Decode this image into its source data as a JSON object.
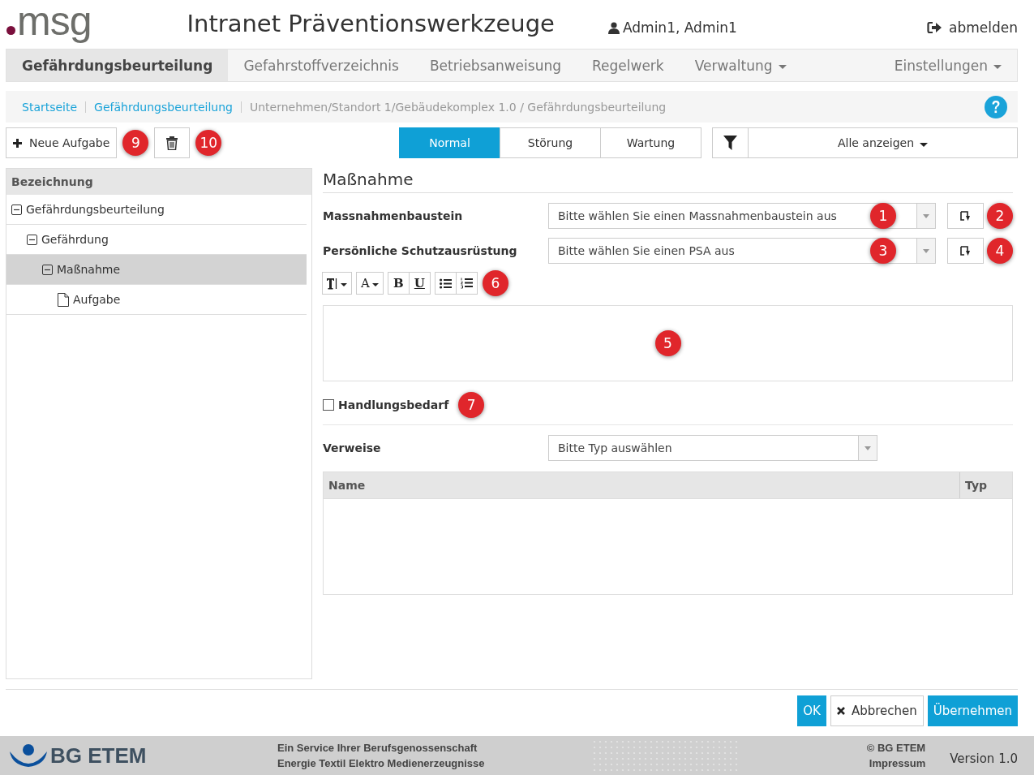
{
  "header": {
    "logo": "msg",
    "title": "Intranet Präventionswerkzeuge",
    "user": "Admin1, Admin1",
    "logout": "abmelden"
  },
  "nav": [
    {
      "label": "Gefährdungsbeurteilung",
      "selected": true,
      "dropdown": false
    },
    {
      "label": "Gefahrstoffverzeichnis",
      "selected": false,
      "dropdown": false
    },
    {
      "label": "Betriebsanweisung",
      "selected": false,
      "dropdown": false
    },
    {
      "label": "Regelwerk",
      "selected": false,
      "dropdown": false
    },
    {
      "label": "Verwaltung",
      "selected": false,
      "dropdown": true
    },
    {
      "label": "Einstellungen",
      "selected": false,
      "dropdown": true
    }
  ],
  "breadcrumb": {
    "links": [
      "Startseite",
      "Gefährdungsbeurteilung"
    ],
    "path": "Unternehmen/Standort 1/Gebäudekomplex 1.0 / Gefährdungsbeurteilung"
  },
  "toolbar": {
    "new_button": {
      "label": "Neue Aufgabe",
      "callout": "9"
    },
    "delete_button": {
      "callout": "10"
    },
    "modes": [
      {
        "label": "Normal",
        "selected": true
      },
      {
        "label": "Störung",
        "selected": false
      },
      {
        "label": "Wartung",
        "selected": false
      }
    ],
    "filter": {
      "label": "Alle anzeigen"
    }
  },
  "tree": {
    "header": "Bezeichnung",
    "items": [
      {
        "label": "Gefährdungsbeurteilung",
        "kind": "folder",
        "expanded": true,
        "selected": false,
        "children": [
          {
            "label": "Gefährdung",
            "kind": "folder",
            "expanded": true,
            "selected": false,
            "children": [
              {
                "label": "Maßnahme",
                "kind": "folder",
                "expanded": true,
                "selected": true,
                "children": [
                  {
                    "label": "Aufgabe",
                    "kind": "document",
                    "expanded": false,
                    "selected": false
                  }
                ]
              }
            ]
          }
        ]
      }
    ]
  },
  "form": {
    "heading": "Maßnahme",
    "selects": [
      {
        "label": "Massnahmenbaustein",
        "placeholder": "Bitte wählen Sie einen Massnahmenbaustein aus",
        "callout": "1",
        "action_callout": "2"
      },
      {
        "label": "Persönliche Schutzausrüstung",
        "placeholder": "Bitte wählen Sie einen PSA aus",
        "callout": "3",
        "action_callout": "4"
      }
    ],
    "editor_toolbar": {
      "buttons": [
        {
          "kind": "size"
        },
        {
          "kind": "color",
          "label": "A"
        },
        {
          "kind": "bold",
          "label": "B"
        },
        {
          "kind": "underline",
          "label": "U"
        },
        {
          "kind": "bullets"
        },
        {
          "kind": "numbers"
        }
      ],
      "callout": "6"
    },
    "editor": {
      "callout": "5"
    },
    "checkbox": {
      "label": "Handlungsbedarf",
      "checked": false,
      "callout": "7"
    },
    "references": {
      "label": "Verweise",
      "placeholder": "Bitte Typ auswählen",
      "columns": [
        "Name",
        "Typ"
      ]
    }
  },
  "buttons": [
    {
      "label": "OK",
      "kind": "primary"
    },
    {
      "label": "Abbrechen",
      "kind": "cancel"
    },
    {
      "label": "Übernehmen",
      "kind": "primary"
    }
  ],
  "footer": {
    "brand": "BG ETEM",
    "tagline": [
      "Ein Service Ihrer Berufsgenossenschaft",
      "Energie Textil Elektro Medienerzeugnisse"
    ],
    "copyright": "© BG ETEM",
    "impressum": "Impressum",
    "version": "Version 1.0"
  }
}
